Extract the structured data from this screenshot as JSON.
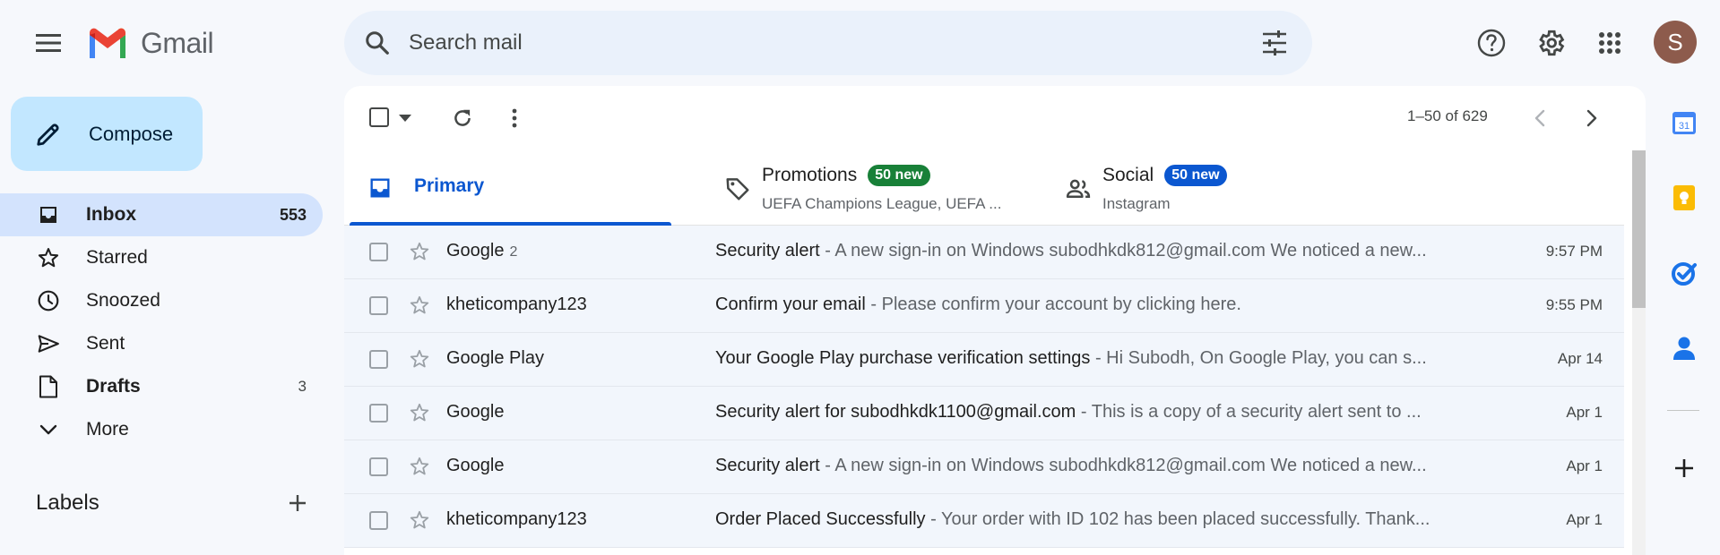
{
  "app": {
    "logo_text": "Gmail"
  },
  "search": {
    "placeholder": "Search mail"
  },
  "account": {
    "avatar_letter": "S",
    "avatar_color": "#8d5b4c"
  },
  "compose": {
    "label": "Compose"
  },
  "sidebar": {
    "items": [
      {
        "label": "Inbox",
        "count": "553",
        "icon": "inbox-icon"
      },
      {
        "label": "Starred",
        "count": "",
        "icon": "star-icon"
      },
      {
        "label": "Snoozed",
        "count": "",
        "icon": "clock-icon"
      },
      {
        "label": "Sent",
        "count": "",
        "icon": "send-icon"
      },
      {
        "label": "Drafts",
        "count": "3",
        "icon": "draft-icon"
      },
      {
        "label": "More",
        "count": "",
        "icon": "chevron-down-icon"
      }
    ],
    "labels_title": "Labels"
  },
  "toolbar": {
    "range": "1–50 of 629"
  },
  "tabs": {
    "primary": {
      "label": "Primary"
    },
    "promotions": {
      "label": "Promotions",
      "badge": "50 new",
      "badge_color": "#188038",
      "sub": "UEFA Champions League, UEFA ..."
    },
    "social": {
      "label": "Social",
      "badge": "50 new",
      "badge_color": "#0b57d0",
      "sub": "Instagram"
    }
  },
  "emails": [
    {
      "sender": "Google",
      "count": "2",
      "subject": "Security alert",
      "snippet": "A new sign-in on Windows subodhkdk812@gmail.com We noticed a new...",
      "date": "9:57 PM"
    },
    {
      "sender": "kheticompany123",
      "count": "",
      "subject": "Confirm your email",
      "snippet": "Please confirm your account by clicking here.",
      "date": "9:55 PM"
    },
    {
      "sender": "Google Play",
      "count": "",
      "subject": "Your Google Play purchase verification settings",
      "snippet": "Hi Subodh, On Google Play, you can s...",
      "date": "Apr 14"
    },
    {
      "sender": "Google",
      "count": "",
      "subject": "Security alert for subodhkdk1100@gmail.com",
      "snippet": "This is a copy of a security alert sent to ...",
      "date": "Apr 1"
    },
    {
      "sender": "Google",
      "count": "",
      "subject": "Security alert",
      "snippet": "A new sign-in on Windows subodhkdk812@gmail.com We noticed a new...",
      "date": "Apr 1"
    },
    {
      "sender": "kheticompany123",
      "count": "",
      "subject": "Order Placed Successfully",
      "snippet": "Your order with ID 102 has been placed successfully. Thank...",
      "date": "Apr 1"
    }
  ],
  "rail": {
    "calendar_day": "31"
  }
}
